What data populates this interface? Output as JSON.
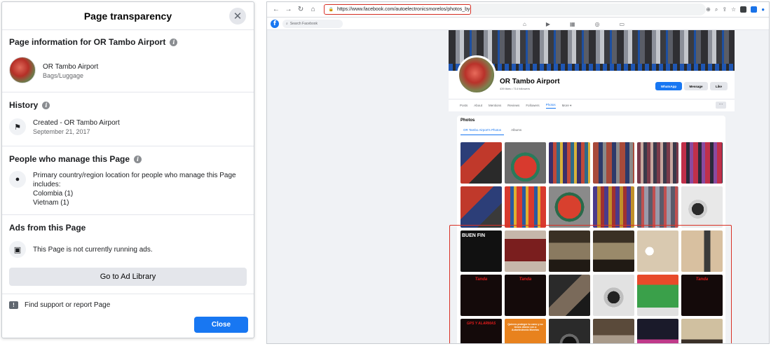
{
  "dialog": {
    "title": "Page transparency",
    "page_info": {
      "heading": "Page information for OR Tambo Airport",
      "name": "OR Tambo Airport",
      "category": "Bags/Luggage"
    },
    "history": {
      "heading": "History",
      "created": "Created - OR Tambo Airport",
      "date": "September 21, 2017"
    },
    "managers": {
      "heading": "People who manage this Page",
      "line1": "Primary country/region location for people who manage this Page",
      "line2": "includes:",
      "country1": "Colombia (1)",
      "country2": "Vietnam (1)"
    },
    "ads": {
      "heading": "Ads from this Page",
      "status": "This Page is not currently running ads.",
      "button": "Go to Ad Library"
    },
    "support": "Find support or report Page",
    "close": "Close"
  },
  "browser": {
    "url": "https://www.facebook.com/autoelectronicsmorelos/photos_by",
    "search_placeholder": "Search Facebook",
    "fb_logo": "f"
  },
  "fbpage": {
    "name": "OR Tambo Airport",
    "stats": "439 likes • 714 followers",
    "whatsapp": "WhatsApp",
    "message": "Message",
    "like": "Like",
    "tabs": [
      "Posts",
      "About",
      "Mentions",
      "Reviews",
      "Followers",
      "Photos",
      "More ▾"
    ],
    "more_button": "···",
    "photos_title": "Photos",
    "photo_tabs": [
      "OR Tambo Airport's Photos",
      "Albums"
    ],
    "tile_labels": {
      "buen_fin": "BUEN FIN",
      "tanda": "Tanda",
      "gps": "GPS Y ALARMAS",
      "promo": "Quieres proteger tu carro y no tienes dinero ven a Autoelectronic Morelos"
    }
  },
  "colors": {
    "accent": "#1877f2",
    "highlight": "#d93025"
  }
}
